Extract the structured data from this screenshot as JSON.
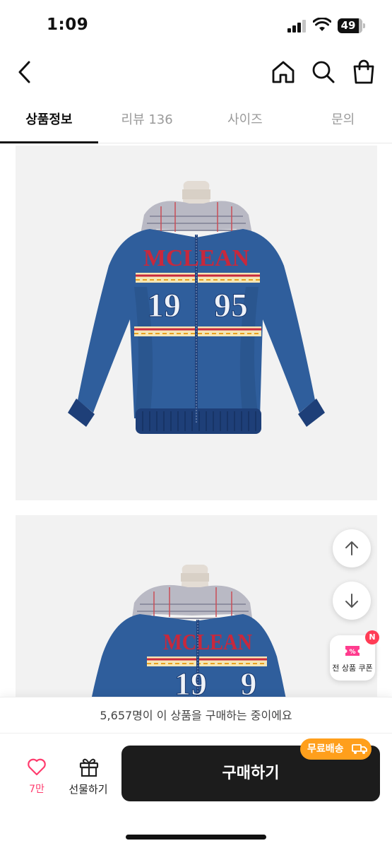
{
  "status_bar": {
    "time": "1:09",
    "battery": "49"
  },
  "header": {
    "back_icon": "chevron-left-icon",
    "home_icon": "home-icon",
    "search_icon": "search-icon",
    "cart_icon": "shopping-bag-icon"
  },
  "tabs": [
    {
      "label": "상품정보",
      "active": true
    },
    {
      "label": "리뷰 136",
      "active": false
    },
    {
      "label": "사이즈",
      "active": false
    },
    {
      "label": "문의",
      "active": false
    }
  ],
  "product_images": [
    {
      "brand_text": "MCLEAN",
      "number_left": "19",
      "number_right": "95"
    },
    {
      "brand_text": "MCLEAN",
      "number_left": "19",
      "number_right": "9"
    }
  ],
  "floating": {
    "scroll_up_icon": "arrow-up-icon",
    "scroll_down_icon": "arrow-down-icon",
    "coupon_label": "전 상품 쿠폰",
    "coupon_badge": "N"
  },
  "purchase_notice": "5,657명이 이 상품을 구매하는 중이에요",
  "actions": {
    "like_count": "7만",
    "gift_label": "선물하기",
    "buy_label": "구매하기",
    "free_shipping_label": "무료배송"
  },
  "colors": {
    "accent_pink": "#ff3c6e",
    "buy_button": "#1c1c1c",
    "free_shipping": "#ff9f1c",
    "jacket_blue": "#2f5e9c",
    "lettering_red": "#c8283c"
  }
}
